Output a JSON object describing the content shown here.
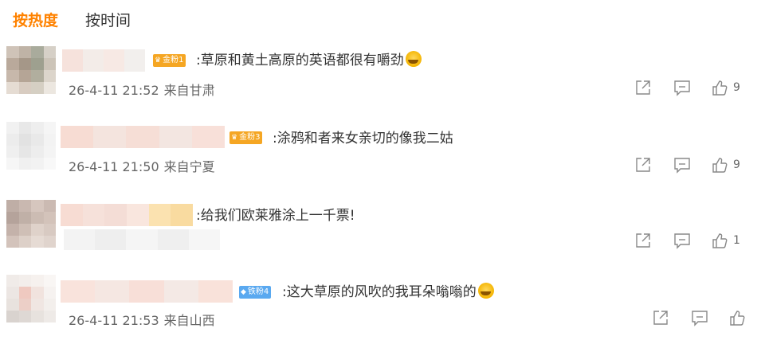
{
  "tabs": [
    {
      "label": "按热度",
      "active": true
    },
    {
      "label": "按时间",
      "active": false
    }
  ],
  "colors": {
    "accent": "#ff8200",
    "badge_gold": "#f5a623",
    "badge_iron": "#5aa9f0"
  },
  "comments": [
    {
      "badge": "金粉1",
      "badge_type": "gold",
      "text": ":草原和黄土高原的英语都很有嚼劲",
      "emoji": "laughing-crying",
      "time": "26-4-11 21:52",
      "location": "来自甘肃",
      "likes": "9"
    },
    {
      "badge": "金粉3",
      "badge_type": "gold",
      "text": ":涂鸦和者来女亲切的像我二姑",
      "time": "26-4-11 21:50",
      "location": "来自宁夏",
      "likes": "9"
    },
    {
      "text": ":给我们欧莱雅涂上一千票!",
      "likes": "1"
    },
    {
      "badge": "铁粉4",
      "badge_type": "iron",
      "text": ":这大草原的风吹的我耳朵嗡嗡的",
      "emoji": "laughing-crying",
      "time": "26-4-11 21:53",
      "location": "来自山西",
      "likes": ""
    }
  ]
}
